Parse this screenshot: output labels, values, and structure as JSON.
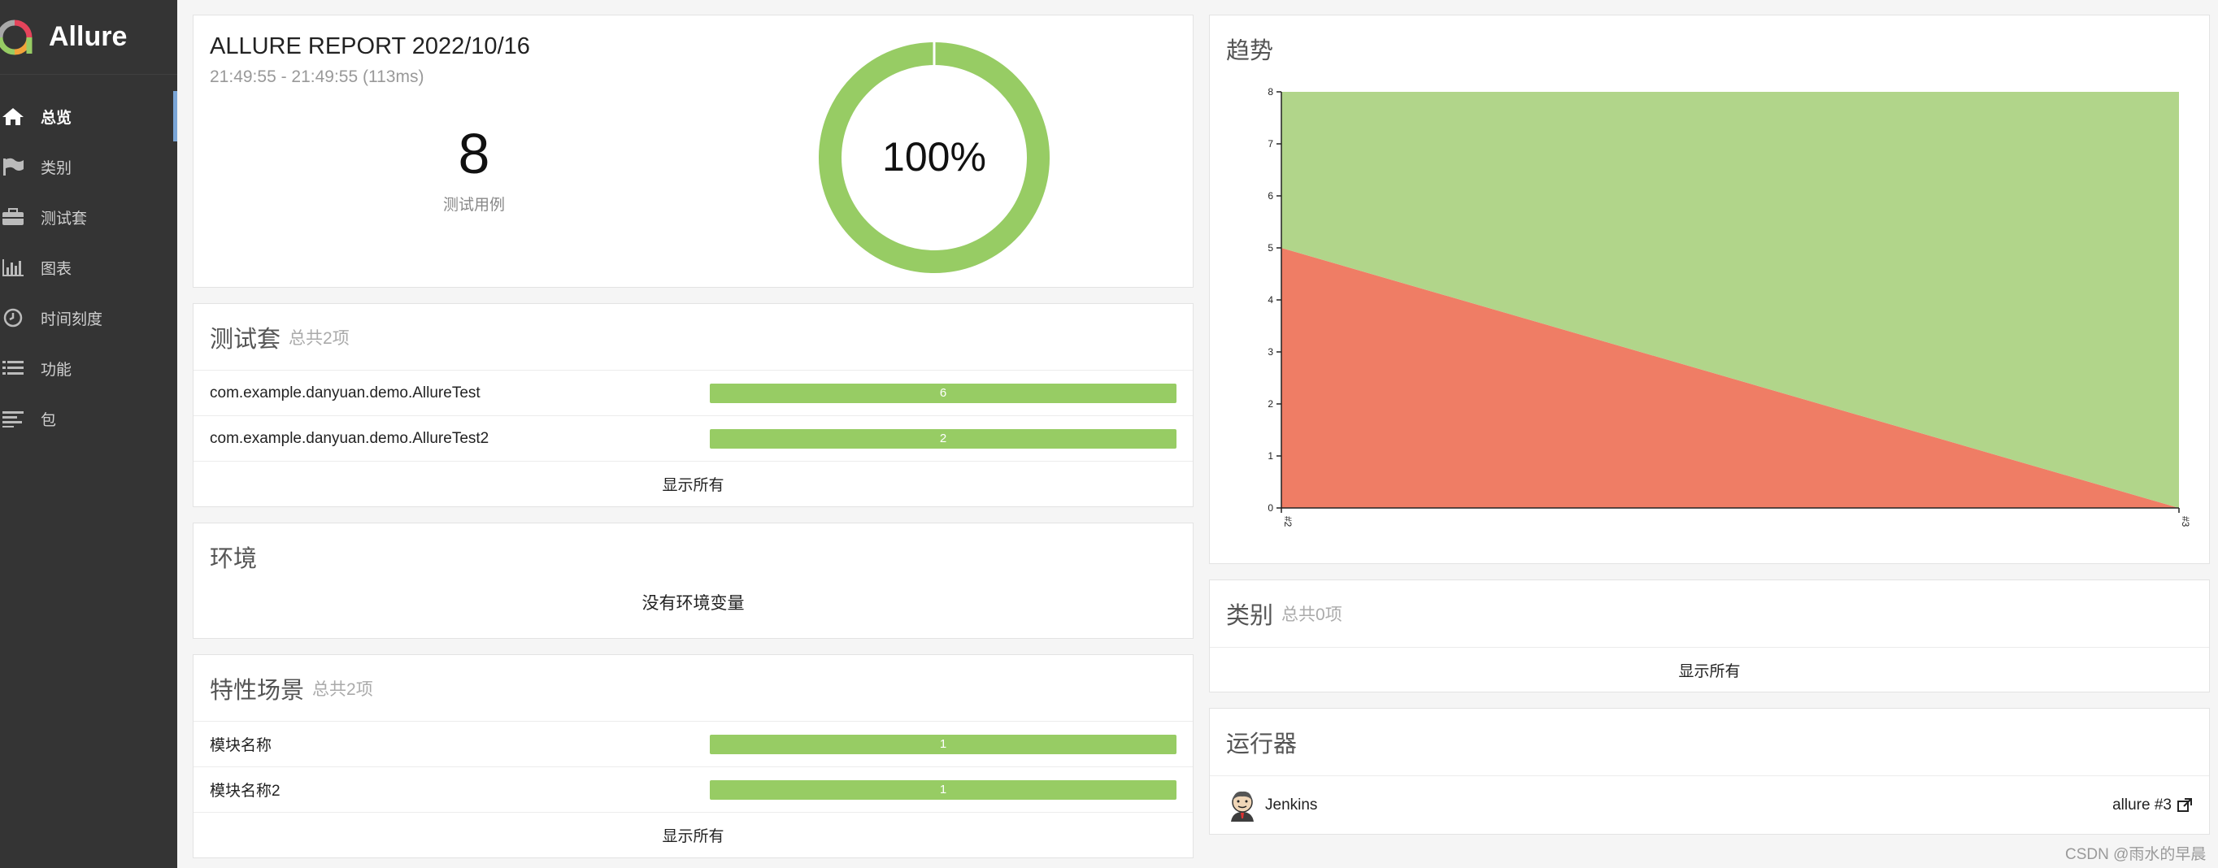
{
  "brand": {
    "name": "Allure"
  },
  "nav": [
    {
      "label": "总览",
      "icon": "home-icon",
      "active": true
    },
    {
      "label": "类别",
      "icon": "flag-icon"
    },
    {
      "label": "测试套",
      "icon": "briefcase-icon"
    },
    {
      "label": "图表",
      "icon": "bar-chart-icon"
    },
    {
      "label": "时间刻度",
      "icon": "clock-icon"
    },
    {
      "label": "功能",
      "icon": "list-icon"
    },
    {
      "label": "包",
      "icon": "align-left-icon"
    }
  ],
  "summary": {
    "title": "ALLURE REPORT 2022/10/16",
    "time": "21:49:55 - 21:49:55 (113ms)",
    "total": "8",
    "total_label": "测试用例",
    "percent": "100%",
    "pass_fraction": 1.0,
    "color": "#97cc64"
  },
  "suites": {
    "title": "测试套",
    "count": "总共2项",
    "items": [
      {
        "name": "com.example.danyuan.demo.AllureTest",
        "value": "6"
      },
      {
        "name": "com.example.danyuan.demo.AllureTest2",
        "value": "2"
      }
    ],
    "show_all": "显示所有"
  },
  "environment": {
    "title": "环境",
    "empty": "没有环境变量"
  },
  "features": {
    "title": "特性场景",
    "count": "总共2项",
    "items": [
      {
        "name": "模块名称",
        "value": "1"
      },
      {
        "name": "模块名称2",
        "value": "1"
      }
    ],
    "show_all": "显示所有"
  },
  "trend": {
    "title": "趋势"
  },
  "chart_data": {
    "type": "area",
    "x": [
      "#2",
      "#3"
    ],
    "series": [
      {
        "values": [
          5,
          0
        ],
        "color": "#ef7d65"
      },
      {
        "values": [
          3,
          8
        ],
        "color": "#b1d58a"
      }
    ],
    "ylim": [
      0,
      8
    ],
    "yticks": [
      "0",
      "1",
      "2",
      "3",
      "4",
      "5",
      "6",
      "7",
      "8"
    ],
    "stacked": true
  },
  "categories": {
    "title": "类别",
    "count": "总共0项",
    "show_all": "显示所有"
  },
  "executors": {
    "title": "运行器",
    "name": "Jenkins",
    "build": "allure #3"
  },
  "watermark": "CSDN @雨水的早晨"
}
